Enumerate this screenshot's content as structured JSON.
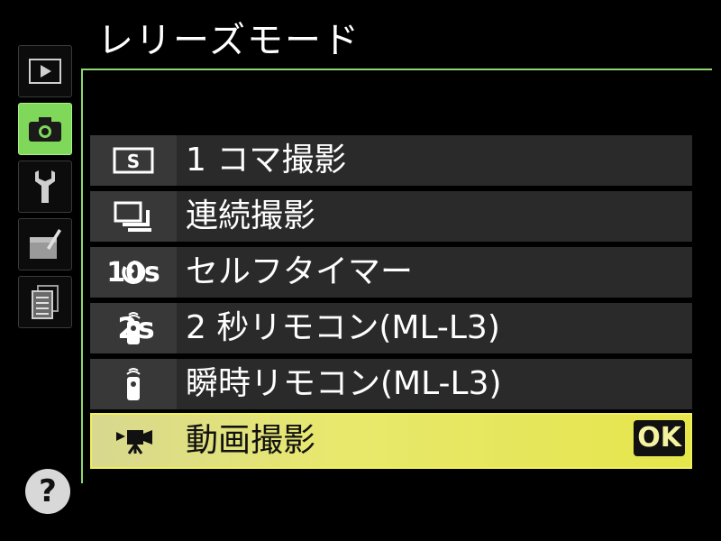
{
  "screen": {
    "title": "レリーズモード"
  },
  "tabs": [
    {
      "id": "playback",
      "icon": "playback-icon"
    },
    {
      "id": "shooting",
      "icon": "camera-icon",
      "active": true
    },
    {
      "id": "setup",
      "icon": "wrench-icon"
    },
    {
      "id": "retouch",
      "icon": "retouch-brush-icon"
    },
    {
      "id": "recent",
      "icon": "recent-settings-icon"
    }
  ],
  "help": {
    "symbol": "?"
  },
  "menu": {
    "items": [
      {
        "icon": "single-frame-icon",
        "icon_text": "",
        "label": "1 コマ撮影"
      },
      {
        "icon": "continuous-icon",
        "icon_text": "",
        "label": "連続撮影"
      },
      {
        "icon": "self-timer-icon",
        "icon_text": "10s",
        "label": "セルフタイマー"
      },
      {
        "icon": "remote-icon",
        "icon_text": "2s",
        "label": "2 秒リモコン(ML-L3)"
      },
      {
        "icon": "remote-icon",
        "icon_text": "",
        "label": "瞬時リモコン(ML-L3)"
      },
      {
        "icon": "movie-camera-icon",
        "icon_text": "",
        "label": "動画撮影",
        "selected": true
      }
    ],
    "ok_label": "OK"
  },
  "colors": {
    "active_tab": "#7fd85a",
    "selection": "#e5e54c",
    "row_bg": "#2a2a2a",
    "frame_line": "#8dd870"
  }
}
